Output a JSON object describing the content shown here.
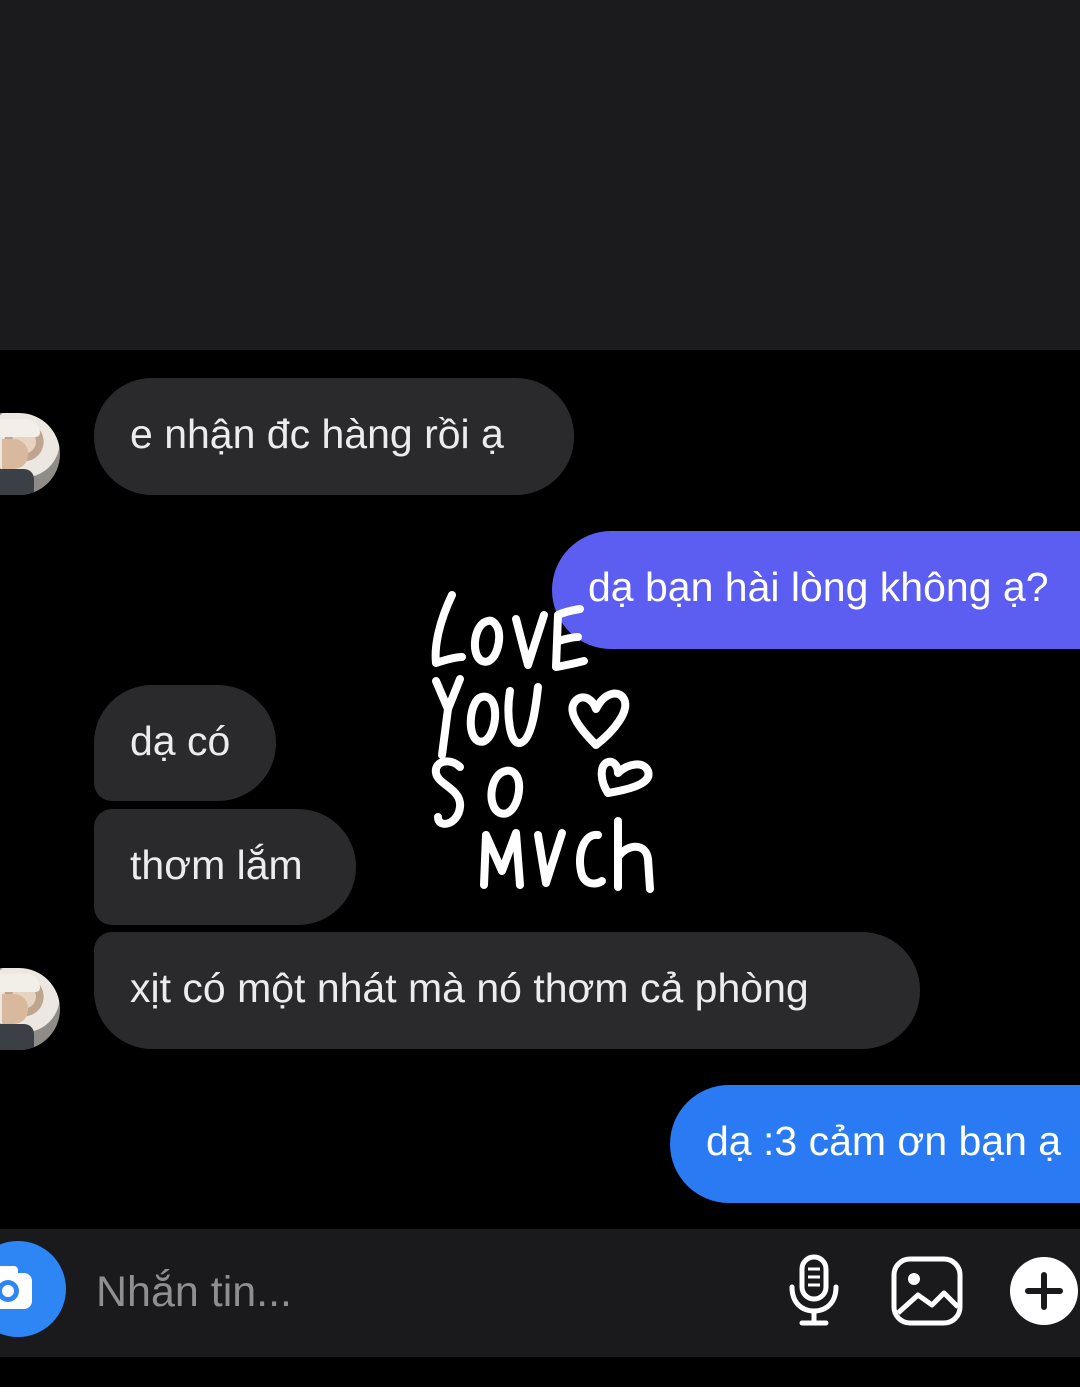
{
  "messages": [
    {
      "id": "m1",
      "from": "them",
      "text": "e nhận đc hàng rồi ạ"
    },
    {
      "id": "m2",
      "from": "me",
      "text": "dạ bạn hài lòng không ạ?"
    },
    {
      "id": "m3",
      "from": "them",
      "text": "dạ có"
    },
    {
      "id": "m4",
      "from": "them",
      "text": "thơm lắm"
    },
    {
      "id": "m5",
      "from": "them",
      "text": "xịt có một nhát mà nó thơm cả phòng"
    },
    {
      "id": "m6",
      "from": "me",
      "text": "dạ :3 cảm ơn bạn ạ"
    }
  ],
  "sticker": {
    "lines": [
      "LOVE",
      "YOU",
      "SO",
      "MUCH"
    ]
  },
  "composer": {
    "placeholder": "Nhắn tin...",
    "icons": [
      "camera-icon",
      "microphone-icon",
      "image-icon",
      "plus-icon"
    ]
  },
  "colors": {
    "background": "#000000",
    "header_area": "#1b1b1d",
    "incoming_bubble": "#2a2a2c",
    "outgoing_bubble_top": "#5b5ef0",
    "outgoing_bubble_bottom": "#2a7af4",
    "camera_button": "#2e86f5"
  }
}
